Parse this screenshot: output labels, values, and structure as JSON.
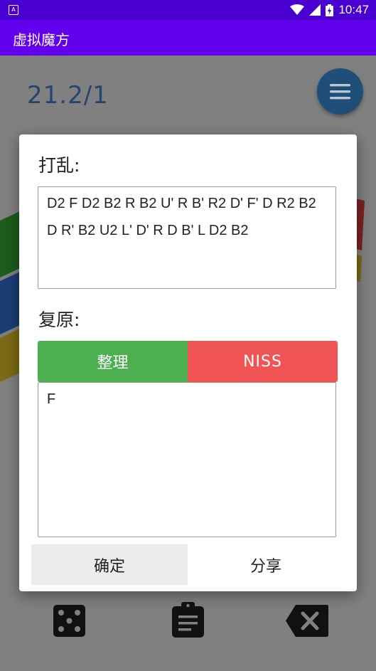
{
  "statusbar": {
    "time": "10:47",
    "app_icon_letter": "A"
  },
  "appbar": {
    "title": "虚拟魔方"
  },
  "main": {
    "timer_text": "21.2/1"
  },
  "dialog": {
    "scramble_label": "打乱:",
    "scramble_text": "D2 F D2 B2 R B2 U' R B' R2 D' F' D R2 B2 D R' B2 U2 L' D' R D B' L D2 B2",
    "solution_label": "复原:",
    "sort_button": "整理",
    "niss_button": "NISS",
    "solution_text": "F",
    "confirm_button": "确定",
    "share_button": "分享"
  },
  "colors": {
    "status_bar": "#4a00d0",
    "app_bar": "#6200ee",
    "sort_green": "#4caf50",
    "niss_red": "#f15454",
    "fab_blue": "#1f4f79"
  },
  "icons": {
    "fab": "menu-icon",
    "bottom_left": "dice-icon",
    "bottom_center": "clipboard-icon",
    "bottom_right": "backspace-icon"
  }
}
